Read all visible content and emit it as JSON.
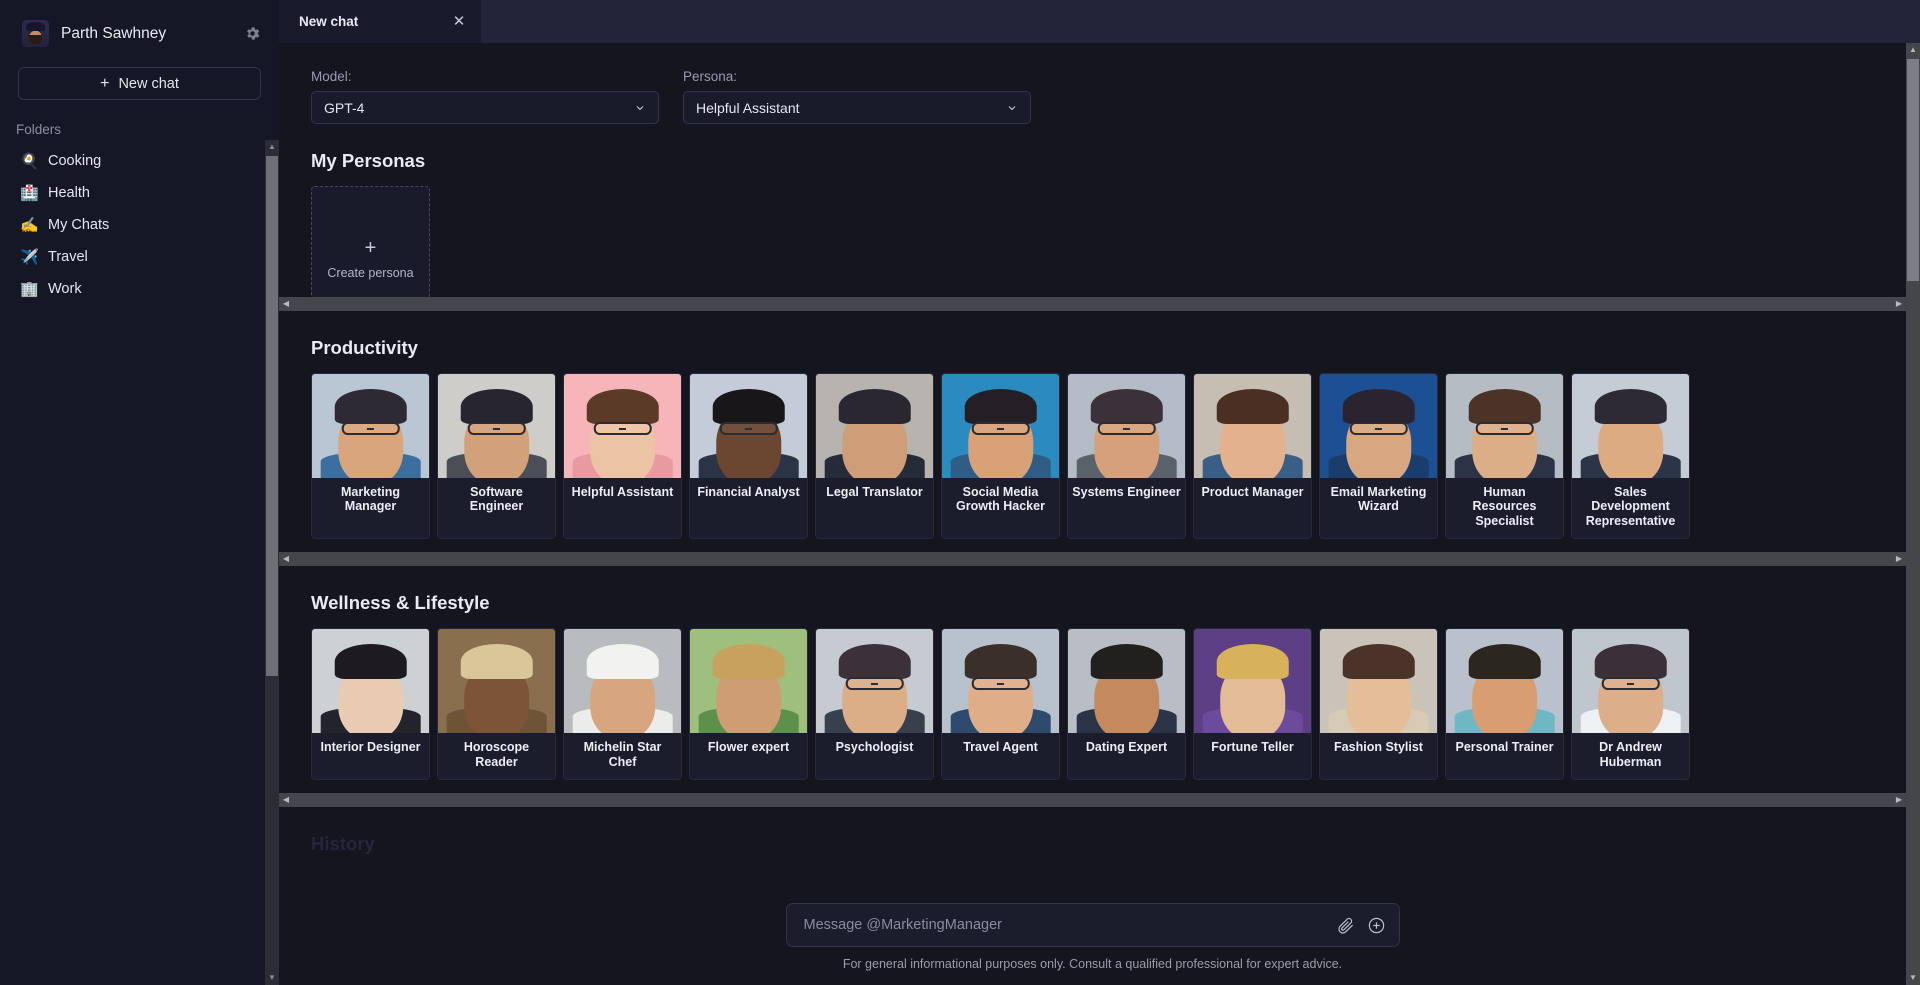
{
  "sidebar": {
    "user_name": "Parth Sawhney",
    "settings_icon": "gear-icon",
    "new_chat_label": "New chat",
    "new_chat_plus": "+",
    "folders_label": "Folders",
    "folders": [
      {
        "label": "Cooking",
        "emoji": "🍳"
      },
      {
        "label": "Health",
        "emoji": "🏥"
      },
      {
        "label": "My Chats",
        "emoji": "✍️"
      },
      {
        "label": "Travel",
        "emoji": "✈️"
      },
      {
        "label": "Work",
        "emoji": "🏢"
      }
    ]
  },
  "tabs": [
    {
      "label": "New chat",
      "close": "✕"
    }
  ],
  "selectors": {
    "model": {
      "label": "Model:",
      "value": "GPT-4"
    },
    "persona": {
      "label": "Persona:",
      "value": "Helpful Assistant"
    }
  },
  "sections": [
    {
      "title": "My Personas",
      "create_label": "Create persona",
      "create_plus": "+",
      "cards": []
    },
    {
      "title": "Productivity",
      "cards": [
        {
          "name": "Marketing Manager",
          "bg": "#b9c6d4",
          "skin": "#d9a57c",
          "hair": "#2d2a33",
          "shirt": "#3d6f9e",
          "glasses": true
        },
        {
          "name": "Software Engineer",
          "bg": "#cfcdc9",
          "skin": "#d2a17a",
          "hair": "#272530",
          "shirt": "#4a4f57",
          "glasses": true
        },
        {
          "name": "Helpful Assistant",
          "bg": "#f6b5b8",
          "skin": "#ecc3a4",
          "hair": "#5b3a27",
          "shirt": "#e79aa0",
          "glasses": true
        },
        {
          "name": "Financial Analyst",
          "bg": "#c3ccd8",
          "skin": "#6b4630",
          "hair": "#19161a",
          "shirt": "#2b3347",
          "glasses": true
        },
        {
          "name": "Legal Translator",
          "bg": "#b7b4b0",
          "skin": "#cf9e78",
          "hair": "#2a2730",
          "shirt": "#262b38",
          "glasses": false
        },
        {
          "name": "Social Media Growth Hacker",
          "bg": "#2b8bbf",
          "skin": "#d8a178",
          "hair": "#241f25",
          "shirt": "#2f5d86",
          "glasses": true
        },
        {
          "name": "Systems Engineer",
          "bg": "#b3bcc6",
          "skin": "#d6a17a",
          "hair": "#3a3238",
          "shirt": "#59616b",
          "glasses": true
        },
        {
          "name": "Product Manager",
          "bg": "#c6bdb3",
          "skin": "#e3b18d",
          "hair": "#4a2f22",
          "shirt": "#3a5f86",
          "glasses": false
        },
        {
          "name": "Email Marketing Wizard",
          "bg": "#1c4f93",
          "skin": "#d7a880",
          "hair": "#2a2430",
          "shirt": "#1b3d6d",
          "glasses": true
        },
        {
          "name": "Human Resources Specialist",
          "bg": "#b6bcc4",
          "skin": "#dcae87",
          "hair": "#4b3327",
          "shirt": "#2c3346",
          "glasses": true
        },
        {
          "name": "Sales Development Representative",
          "bg": "#c5ccd5",
          "skin": "#ddab82",
          "hair": "#2e2a33",
          "shirt": "#2c3448",
          "glasses": false
        }
      ]
    },
    {
      "title": "Wellness & Lifestyle",
      "cards": [
        {
          "name": "Interior Designer",
          "bg": "#cdd1d4",
          "skin": "#e9cbb3",
          "hair": "#1d1a20",
          "shirt": "#23232c",
          "glasses": false
        },
        {
          "name": "Horoscope Reader",
          "bg": "#8a6f4f",
          "skin": "#7d5438",
          "hair": "#d9c79a",
          "shirt": "#6d5436",
          "glasses": false
        },
        {
          "name": "Michelin Star Chef",
          "bg": "#b9bcbf",
          "skin": "#d7a67e",
          "hair": "#f2f2f0",
          "shirt": "#ececea",
          "glasses": false
        },
        {
          "name": "Flower expert",
          "bg": "#9fbf7c",
          "skin": "#cf9d74",
          "hair": "#c9a15f",
          "shirt": "#5d8f4d",
          "glasses": false
        },
        {
          "name": "Psychologist",
          "bg": "#c6cbd1",
          "skin": "#dbae88",
          "hair": "#3a3139",
          "shirt": "#39404d",
          "glasses": true
        },
        {
          "name": "Travel Agent",
          "bg": "#b7c2cd",
          "skin": "#dfae88",
          "hair": "#3b2f2a",
          "shirt": "#2e4b6e",
          "glasses": true
        },
        {
          "name": "Dating Expert",
          "bg": "#b9bec6",
          "skin": "#c48a5d",
          "hair": "#22201f",
          "shirt": "#2b3347",
          "glasses": false
        },
        {
          "name": "Fortune Teller",
          "bg": "#5c3f84",
          "skin": "#e3bb97",
          "hair": "#d8b25a",
          "shirt": "#6d4b9c",
          "glasses": false
        },
        {
          "name": "Fashion Stylist",
          "bg": "#c9c3ba",
          "skin": "#e5bd99",
          "hair": "#4a342a",
          "shirt": "#d8cbb6",
          "glasses": false
        },
        {
          "name": "Personal Trainer",
          "bg": "#b9c2cc",
          "skin": "#d89d70",
          "hair": "#2c2620",
          "shirt": "#6fb7c4",
          "glasses": false
        },
        {
          "name": "Dr Andrew Huberman",
          "bg": "#bfc6ce",
          "skin": "#dcae89",
          "hair": "#3a3038",
          "shirt": "#eef1f4",
          "glasses": true
        }
      ]
    }
  ],
  "history_title": "History",
  "composer": {
    "placeholder": "Message @MarketingManager",
    "value": "",
    "attach_icon": "paperclip-icon",
    "add_icon": "plus-circle-icon"
  },
  "disclaimer": "For general informational purposes only. Consult a qualified professional for expert advice.",
  "colors": {
    "app_bg": "#14151f",
    "sidebar_bg": "#151626",
    "tabbar_bg": "#23243a",
    "active_tab_bg": "#191a2b",
    "card_bg": "#1b1c2c",
    "border": "#32334a",
    "scrollbar_track": "#45464c",
    "scrollbar_thumb": "#7d7d85"
  }
}
